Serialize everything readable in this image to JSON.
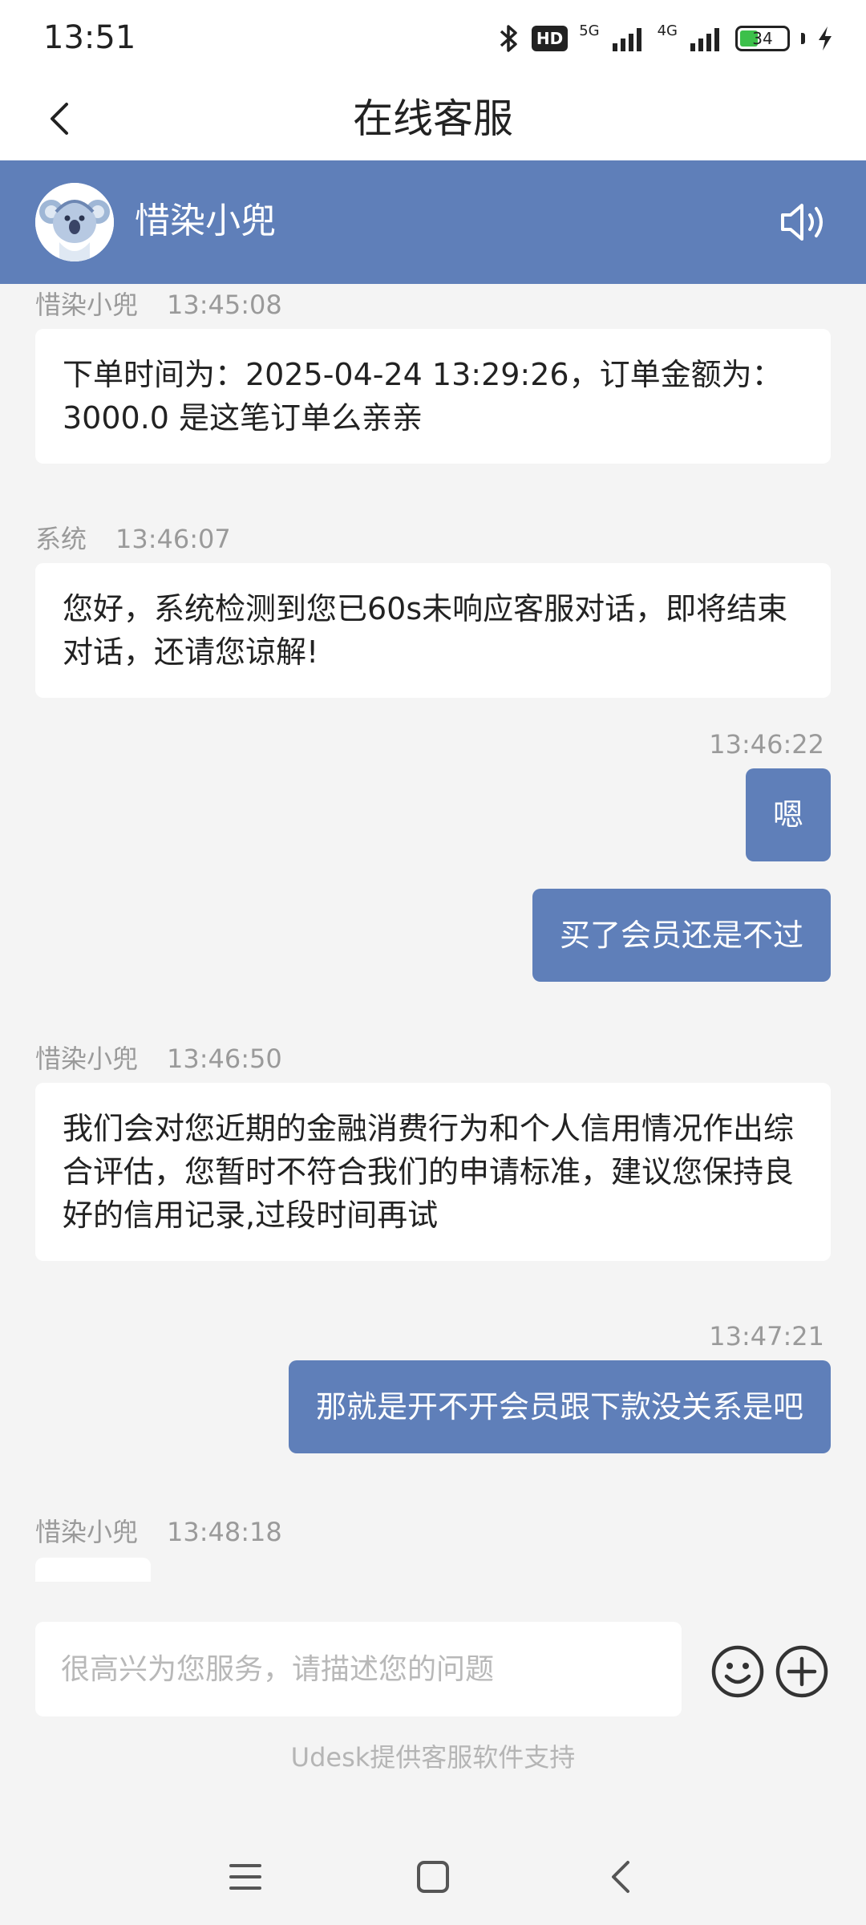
{
  "status_bar": {
    "time": "13:51",
    "hd_label": "HD",
    "net1": "5G",
    "net2": "4G",
    "battery": "34"
  },
  "header": {
    "title": "在线客服"
  },
  "agent": {
    "name": "惜染小兜"
  },
  "messages": [
    {
      "side": "left",
      "sender": "惜染小兜",
      "time": "13:45:08",
      "text": "下单时间为：2025-04-24 13:29:26，订单金额为：3000.0 是这笔订单么亲亲"
    },
    {
      "side": "left",
      "sender": "系统",
      "time": "13:46:07",
      "text": "您好，系统检测到您已60s未响应客服对话，即将结束对话，还请您谅解!"
    },
    {
      "side": "right",
      "time": "13:46:22",
      "text": "嗯"
    },
    {
      "side": "right",
      "text": "买了会员还是不过"
    },
    {
      "side": "left",
      "sender": "惜染小兜",
      "time": "13:46:50",
      "text": "我们会对您近期的金融消费行为和个人信用情况作出综合评估，您暂时不符合我们的申请标准，建议您保持良好的信用记录,过段时间再试"
    },
    {
      "side": "right",
      "time": "13:47:21",
      "text": "那就是开不开会员跟下款没关系是吧"
    },
    {
      "side": "left",
      "sender": "惜染小兜",
      "time": "13:48:18",
      "text": ""
    }
  ],
  "input": {
    "placeholder": "很高兴为您服务，请描述您的问题",
    "value": ""
  },
  "footer": {
    "powered_by": "Udesk提供客服软件支持"
  },
  "colors": {
    "accent": "#5f7fb9",
    "background": "#f4f4f4",
    "bubble_left": "#ffffff",
    "meta_text": "#9a9a9a"
  },
  "icons": {
    "back": "chevron-left-icon",
    "speaker": "speaker-icon",
    "emoji": "smiley-icon",
    "plus": "plus-circle-icon",
    "nav_menu": "menu-icon",
    "nav_home": "square-icon",
    "nav_back": "chevron-left-icon"
  }
}
